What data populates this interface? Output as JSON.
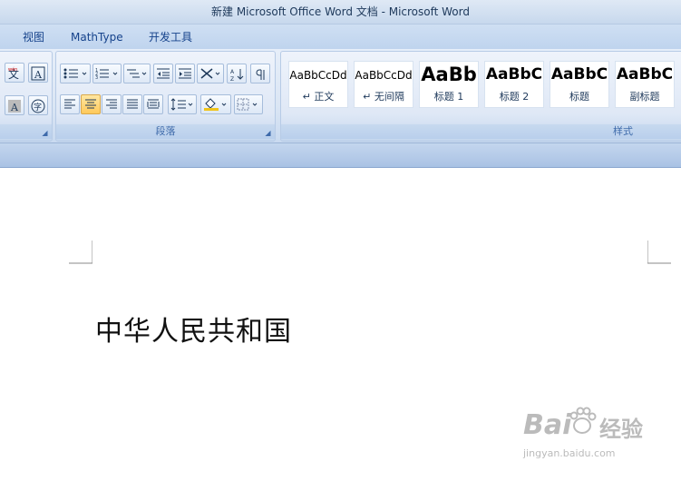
{
  "window": {
    "title": "新建 Microsoft Office Word 文档 - Microsoft Word"
  },
  "tabs": [
    "视图",
    "MathType",
    "开发工具"
  ],
  "ribbon": {
    "groups": {
      "paragraph_label": "段落",
      "styles_label": "样式"
    },
    "styles": [
      {
        "sample": "AaBbCcDd",
        "name": "↵ 正文"
      },
      {
        "sample": "AaBbCcDd",
        "name": "↵ 无间隔"
      },
      {
        "sample": "AaBb",
        "name": "标题 1"
      },
      {
        "sample": "AaBbC",
        "name": "标题 2"
      },
      {
        "sample": "AaBbC",
        "name": "标题"
      },
      {
        "sample": "AaBbC",
        "name": "副标题"
      }
    ]
  },
  "document": {
    "text": "中华人民共和国"
  },
  "watermark": {
    "brand": "Bai",
    "product": "经验",
    "url": "jingyan.baidu.com"
  },
  "colors": {
    "accent": "#15428b",
    "highlight": "#ffc95a"
  }
}
